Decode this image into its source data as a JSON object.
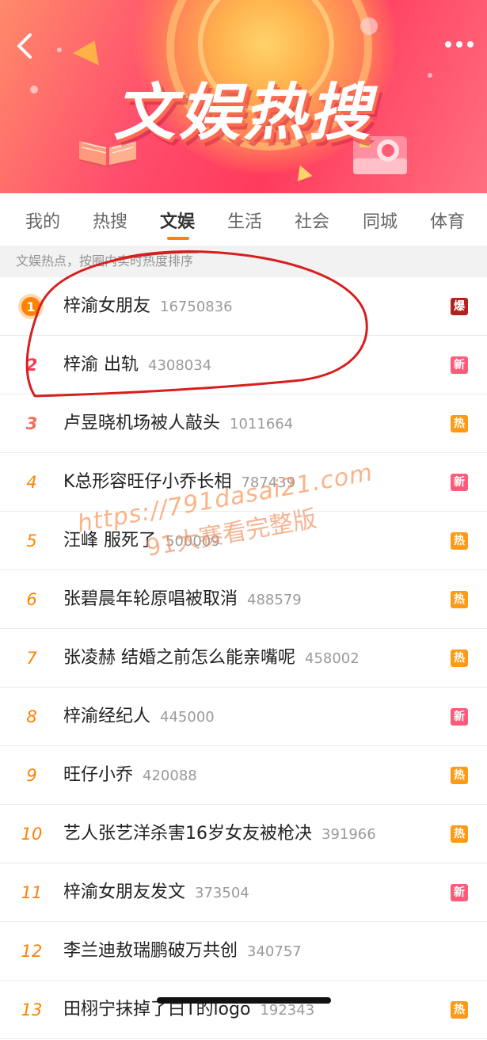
{
  "banner": {
    "title": "文娱热搜",
    "back_icon": "chevron-left-icon",
    "more_icon": "more-dots-icon"
  },
  "tabs": [
    {
      "label": "我的",
      "active": false
    },
    {
      "label": "热搜",
      "active": false
    },
    {
      "label": "文娱",
      "active": true
    },
    {
      "label": "生活",
      "active": false
    },
    {
      "label": "社会",
      "active": false
    },
    {
      "label": "同城",
      "active": false
    },
    {
      "label": "体育",
      "active": false
    }
  ],
  "subheader": "文娱热点，按圈内实时热度排序",
  "items": [
    {
      "rank": "1",
      "title": "梓渝女朋友",
      "count": "16750836",
      "badge": "爆",
      "badge_color": "#b3201e"
    },
    {
      "rank": "2",
      "title": "梓渝 出轨",
      "count": "4308034",
      "badge": "新",
      "badge_color": "#ff5a7a"
    },
    {
      "rank": "3",
      "title": "卢昱晓机场被人敲头",
      "count": "1011664",
      "badge": "热",
      "badge_color": "#ff9a16"
    },
    {
      "rank": "4",
      "title": "K总形容旺仔小乔长相",
      "count": "787439",
      "badge": "新",
      "badge_color": "#ff5a7a"
    },
    {
      "rank": "5",
      "title": "汪峰 服死了",
      "count": "500009",
      "badge": "热",
      "badge_color": "#ff9a16"
    },
    {
      "rank": "6",
      "title": "张碧晨年轮原唱被取消",
      "count": "488579",
      "badge": "热",
      "badge_color": "#ff9a16"
    },
    {
      "rank": "7",
      "title": "张凌赫 结婚之前怎么能亲嘴呢",
      "count": "458002",
      "badge": "热",
      "badge_color": "#ff9a16"
    },
    {
      "rank": "8",
      "title": "梓渝经纪人",
      "count": "445000",
      "badge": "新",
      "badge_color": "#ff5a7a"
    },
    {
      "rank": "9",
      "title": "旺仔小乔",
      "count": "420088",
      "badge": "热",
      "badge_color": "#ff9a16"
    },
    {
      "rank": "10",
      "title": "艺人张艺洋杀害16岁女友被枪决",
      "count": "391966",
      "badge": "热",
      "badge_color": "#ff9a16"
    },
    {
      "rank": "11",
      "title": "梓渝女朋友发文",
      "count": "373504",
      "badge": "新",
      "badge_color": "#ff5a7a"
    },
    {
      "rank": "12",
      "title": "李兰迪敖瑞鹏破万共创",
      "count": "340757",
      "badge": "",
      "badge_color": ""
    },
    {
      "rank": "13",
      "title": "田栩宁抹掉了白T的logo",
      "count": "192343",
      "badge": "热",
      "badge_color": "#ff9a16"
    }
  ],
  "watermark": {
    "url": "https://791dasai21.com",
    "text": "91大赛看完整版"
  },
  "colors": {
    "accent": "#ff8200",
    "annotation_circle": "#d81e1e"
  }
}
